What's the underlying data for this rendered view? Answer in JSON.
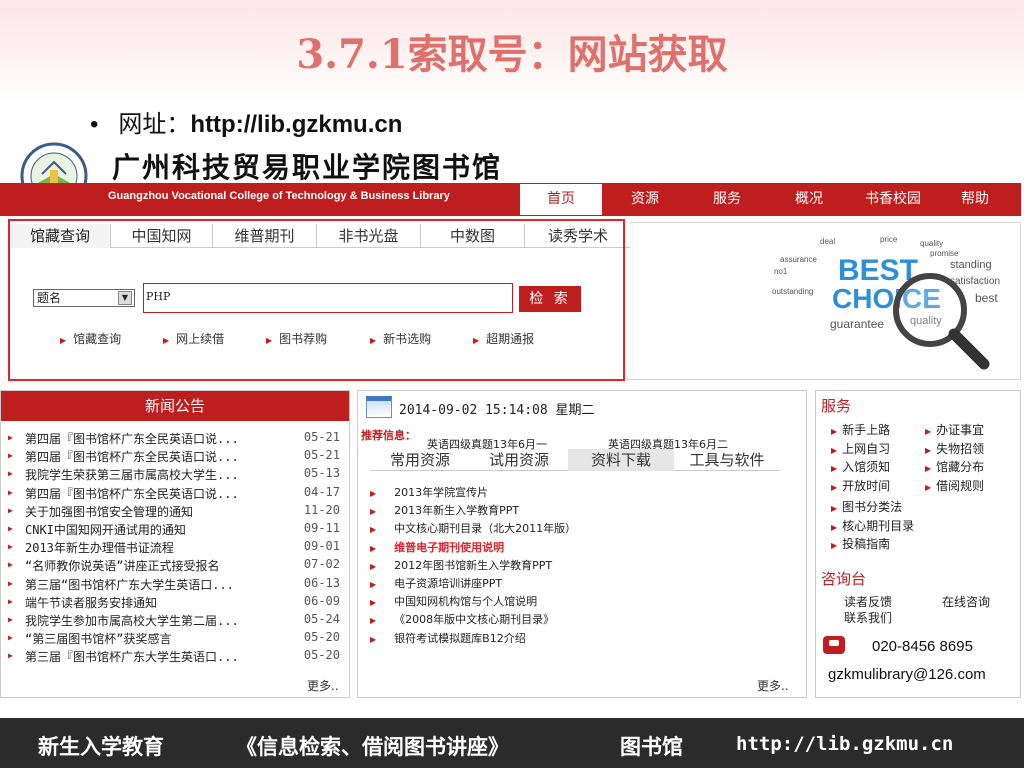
{
  "slide": {
    "title": "3.7.1索取号：网站获取",
    "bullet_prefix": "网址：",
    "bullet_url": "http://lib.gzkmu.cn"
  },
  "library": {
    "name": "广州科技贸易职业学院图书馆",
    "name_en": "Guangzhou Vocational College of Technology & Business Library"
  },
  "nav": {
    "items": [
      "首页",
      "资源",
      "服务",
      "概况",
      "书香校园",
      "帮助"
    ],
    "active_index": 0
  },
  "search": {
    "tabs": [
      "馆藏查询",
      "中国知网",
      "维普期刊",
      "非书光盘",
      "中数图",
      "读秀学术"
    ],
    "active_tab": 0,
    "field": "题名",
    "query": "PHP",
    "button": "检 索",
    "links": [
      "馆藏查询",
      "网上续借",
      "图书荐购",
      "新书选购",
      "超期通报"
    ]
  },
  "news": {
    "header": "新闻公告",
    "items": [
      {
        "title": "第四届『图书馆杯广东全民英语口说...",
        "date": "05-21"
      },
      {
        "title": "第四届『图书馆杯广东全民英语口说...",
        "date": "05-21"
      },
      {
        "title": "我院学生荣获第三届市属高校大学生...",
        "date": "05-13"
      },
      {
        "title": "第四届『图书馆杯广东全民英语口说...",
        "date": "04-17"
      },
      {
        "title": "关于加强图书馆安全管理的通知",
        "date": "11-20"
      },
      {
        "title": "CNKI中国知网开通试用的通知",
        "date": "09-11"
      },
      {
        "title": "2013年新生办理借书证流程",
        "date": "09-01"
      },
      {
        "title": "“名师教你说英语”讲座正式接受报名",
        "date": "07-02"
      },
      {
        "title": "第三届“图书馆杯广东大学生英语口...",
        "date": "06-13"
      },
      {
        "title": "端午节读者服务安排通知",
        "date": "06-09"
      },
      {
        "title": "我院学生参加市属高校大学生第二届...",
        "date": "05-24"
      },
      {
        "title": "“第三届图书馆杯”获奖感言",
        "date": "05-20"
      },
      {
        "title": "第三届『图书馆杯广东大学生英语口...",
        "date": "05-20"
      }
    ],
    "more": "更多.."
  },
  "center": {
    "datetime": "2014-09-02 15:14:08",
    "weekday": "星期二",
    "rec_label": "推荐信息：",
    "rec_items": [
      "英语四级真题13年6月一",
      "英语四级真题13年6月二"
    ],
    "tabs": [
      "常用资源",
      "试用资源",
      "资料下载",
      "工具与软件"
    ],
    "active_tab": 2,
    "items": [
      {
        "title": "2013年学院宣传片",
        "highlight": false
      },
      {
        "title": "2013年新生入学教育PPT",
        "highlight": false
      },
      {
        "title": "中文核心期刊目录（北大2011年版）",
        "highlight": false
      },
      {
        "title": "维普电子期刊使用说明",
        "highlight": true
      },
      {
        "title": "2012年图书馆新生入学教育PPT",
        "highlight": false
      },
      {
        "title": "电子资源培训讲座PPT",
        "highlight": false
      },
      {
        "title": "中国知网机构馆与个人馆说明",
        "highlight": false
      },
      {
        "title": "《2008年版中文核心期刊目录》",
        "highlight": false
      },
      {
        "title": "银符考试模拟题库B12介绍",
        "highlight": false
      }
    ],
    "more": "更多.."
  },
  "services": {
    "header": "服务",
    "col1": [
      "新手上路",
      "上网自习",
      "入馆须知",
      "开放时间"
    ],
    "col2": [
      "办证事宜",
      "失物招领",
      "馆藏分布",
      "借阅规则"
    ],
    "single": [
      "图书分类法",
      "核心期刊目录",
      "投稿指南"
    ],
    "consult_header": "咨询台",
    "feedback": "读者反馈",
    "online": "在线咨询",
    "contact": "联系我们",
    "phone": "020-8456 8695",
    "email": "gzkmulibrary@126.com"
  },
  "ad": {
    "words": [
      "BEST",
      "CHOICE",
      "quality",
      "promise",
      "guarantee",
      "deal",
      "price",
      "standing",
      "assurance",
      "outstanding",
      "no1",
      "satisfaction",
      "best"
    ]
  },
  "footer": {
    "a": "新生入学教育",
    "b": "《信息检索、借阅图书讲座》",
    "c": "图书馆",
    "url": "http://lib.gzkmu.cn"
  },
  "colors": {
    "accent": "#bf1e1e",
    "title": "#e0706c",
    "footer": "#2b2b2b"
  }
}
